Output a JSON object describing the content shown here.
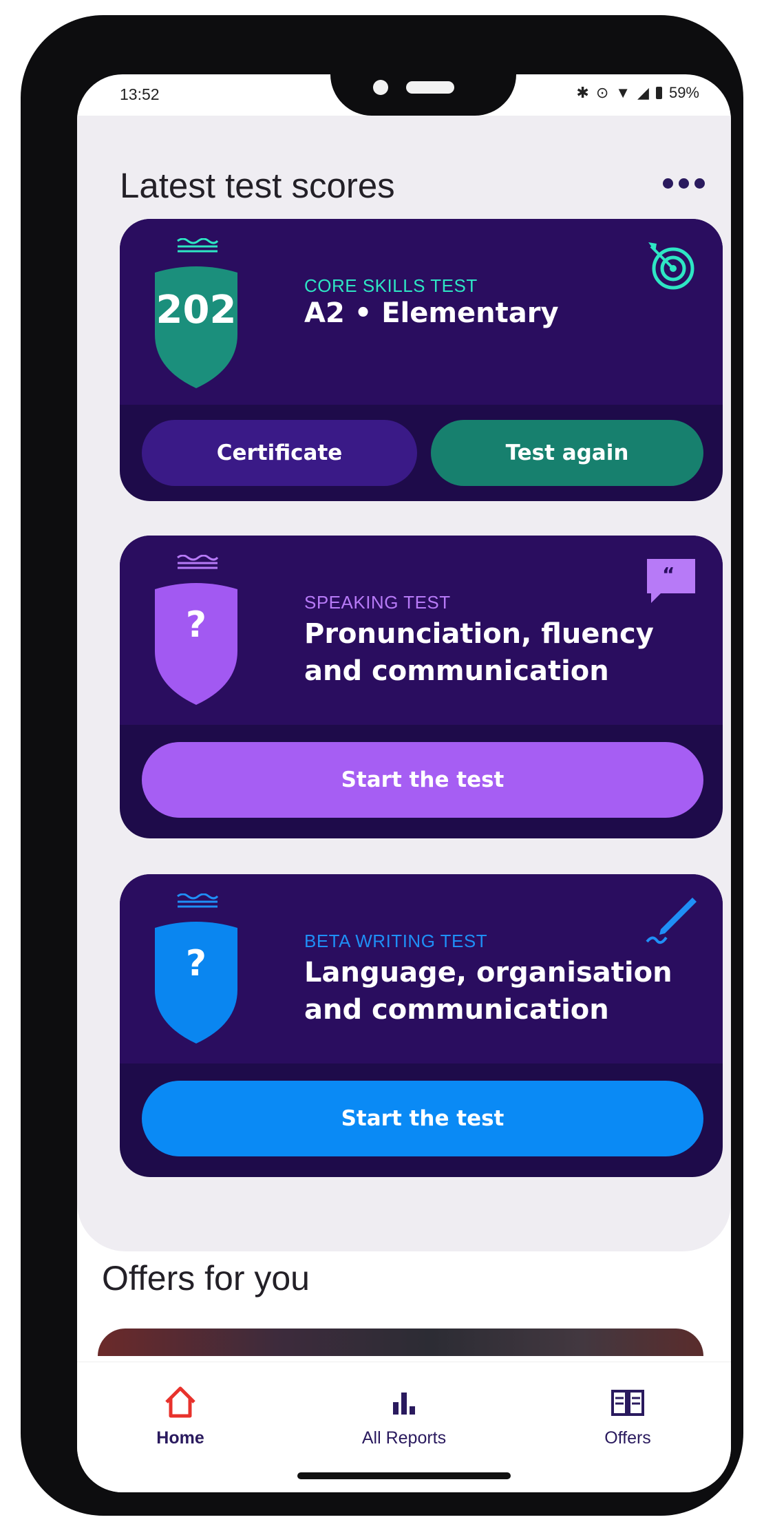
{
  "status_bar": {
    "time": "13:52",
    "battery": "59%"
  },
  "header": {
    "title": "Latest test scores"
  },
  "cards": [
    {
      "eyebrow": "CORE SKILLS TEST",
      "title": "A2 • Elementary",
      "score": "202",
      "icon": "target-icon",
      "colors": {
        "shield": "#1b8f7c",
        "eyebrow": "#2ee6c4"
      },
      "buttons": [
        {
          "label": "Certificate",
          "color": "#3a1a87"
        },
        {
          "label": "Test again",
          "color": "#17806e"
        }
      ]
    },
    {
      "eyebrow": "SPEAKING TEST",
      "title_lines": [
        "Pronunciation, fluency",
        "and communication"
      ],
      "score": "?",
      "icon": "speech-bubble-icon",
      "colors": {
        "shield": "#a259f2",
        "eyebrow": "#b77af7"
      },
      "button": {
        "label": "Start the test",
        "color": "#a65ef3"
      }
    },
    {
      "eyebrow": "BETA WRITING TEST",
      "title_lines": [
        "Language, organisation",
        "and communication"
      ],
      "score": "?",
      "icon": "pen-icon",
      "colors": {
        "shield": "#0a86f0",
        "eyebrow": "#1f8ff6"
      },
      "button": {
        "label": "Start the test",
        "color": "#0a8af5"
      }
    }
  ],
  "offers": {
    "title": "Offers for you"
  },
  "nav": {
    "items": [
      {
        "label": "Home",
        "icon": "home-icon",
        "active": true
      },
      {
        "label": "All Reports",
        "icon": "bar-chart-icon",
        "active": false
      },
      {
        "label": "Offers",
        "icon": "book-icon",
        "active": false
      }
    ],
    "active_color": "#e8322c"
  }
}
